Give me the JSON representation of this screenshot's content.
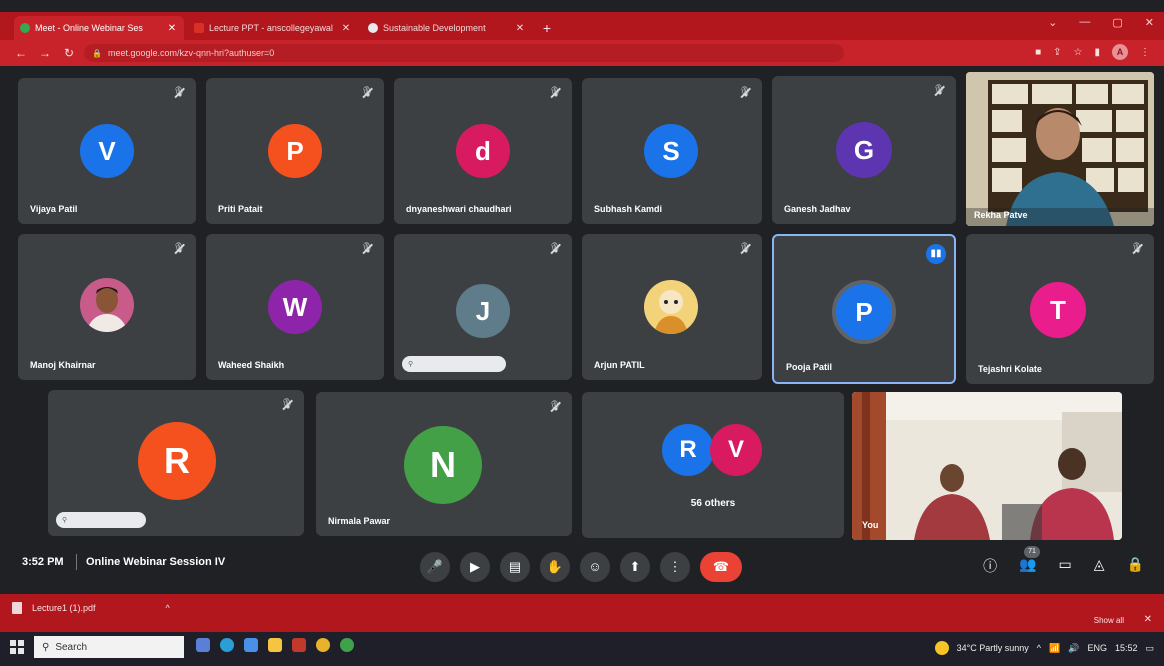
{
  "browser": {
    "tabs": [
      {
        "title": "Meet - Online Webinar Ses",
        "favicon_color": "#34a853"
      },
      {
        "title": "Lecture PPT - anscollegeyawal",
        "favicon_color": "#d93025"
      },
      {
        "title": "Sustainable Development",
        "favicon_color": "#e8eaed"
      }
    ],
    "new_tab": "+",
    "url": "meet.google.com/kzv-qnn-hri?authuser=0",
    "profile_initial": "A"
  },
  "participants": [
    {
      "name": "Vijaya Patil",
      "initial": "V",
      "color": "#1a73e8"
    },
    {
      "name": "Priti Patait",
      "initial": "P",
      "color": "#f4511e"
    },
    {
      "name": "dnyaneshwari chaudhari",
      "initial": "d",
      "color": "#d81b60"
    },
    {
      "name": "Subhash Kamdi",
      "initial": "S",
      "color": "#1a73e8"
    },
    {
      "name": "Ganesh Jadhav",
      "initial": "G",
      "color": "#5e35b1"
    },
    {
      "name": "Rekha Patve"
    },
    {
      "name": "Manoj Khairnar"
    },
    {
      "name": "Waheed Shaikh",
      "initial": "W",
      "color": "#8e24aa"
    },
    {
      "name": "",
      "initial": "J",
      "color": "#5f7c8a"
    },
    {
      "name": "Arjun PATIL"
    },
    {
      "name": "Pooja Patil",
      "initial": "P",
      "color": "#1a73e8"
    },
    {
      "name": "Tejashri Kolate",
      "initial": "T",
      "color": "#e91e8c"
    },
    {
      "name": "",
      "initial": "R",
      "color": "#f4511e"
    },
    {
      "name": "Nirmala Pawar",
      "initial": "N",
      "color": "#43a047"
    }
  ],
  "others": {
    "label": "56 others",
    "avatars": [
      {
        "initial": "R",
        "color": "#1a73e8"
      },
      {
        "initial": "V",
        "color": "#d81b60"
      }
    ]
  },
  "self_tile": {
    "name": "You"
  },
  "meet_bar": {
    "time": "3:52 PM",
    "separator": "|",
    "title": "Online Webinar Session IV",
    "participants_count": "71"
  },
  "download": {
    "file": "Lecture1 (1).pdf",
    "show_all": "Show all"
  },
  "taskbar": {
    "search": "Search",
    "weather": "34°C  Partly sunny",
    "language": "ENG",
    "clock": "15:52"
  }
}
